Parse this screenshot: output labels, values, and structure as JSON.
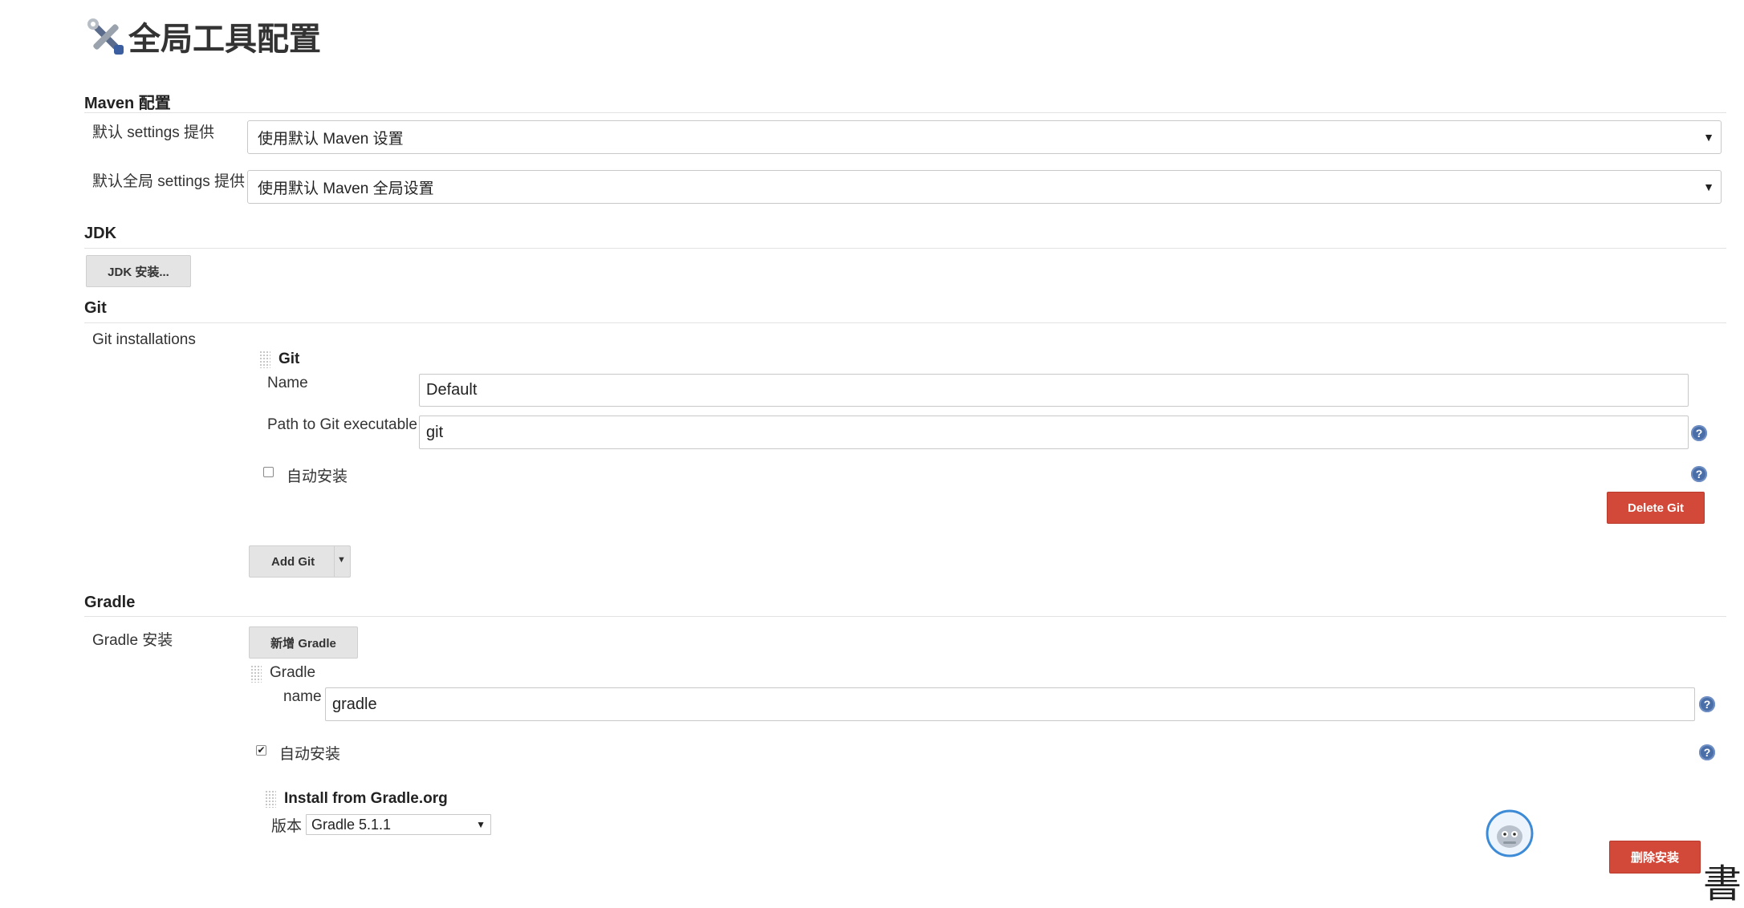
{
  "page": {
    "title": "全局工具配置"
  },
  "maven": {
    "section_title": "Maven 配置",
    "settings_label": "默认 settings 提供",
    "settings_value": "使用默认 Maven 设置",
    "global_settings_label": "默认全局 settings 提供",
    "global_settings_value": "使用默认 Maven 全局设置"
  },
  "jdk": {
    "section_title": "JDK",
    "install_button": "JDK 安装..."
  },
  "git": {
    "section_title": "Git",
    "installations_label": "Git installations",
    "block_title": "Git",
    "name_label": "Name",
    "name_value": "Default",
    "path_label": "Path to Git executable",
    "path_value": "git",
    "auto_install_label": "自动安装",
    "auto_install_checked": false,
    "delete_button": "Delete Git",
    "add_button": "Add Git"
  },
  "gradle": {
    "section_title": "Gradle",
    "installations_label": "Gradle 安装",
    "add_button": "新增 Gradle",
    "block_title": "Gradle",
    "name_label": "name",
    "name_value": "gradle",
    "auto_install_label": "自动安装",
    "auto_install_checked": true,
    "installer_title": "Install from Gradle.org",
    "version_label": "版本",
    "version_value": "Gradle 5.1.1",
    "delete_button": "删除安装"
  },
  "icons": {
    "title_icon": "tools-icon",
    "help_icon": "help-icon",
    "drag_handle": "drag-handle-icon",
    "assistant_icon": "robot-avatar-icon",
    "watermark": "watermark-glyph"
  },
  "colors": {
    "danger": "#d24939",
    "help": "#4a6ea8",
    "button_gray": "#e4e4e4"
  },
  "watermark": {
    "glyph": "書"
  },
  "help_glyph": "?"
}
